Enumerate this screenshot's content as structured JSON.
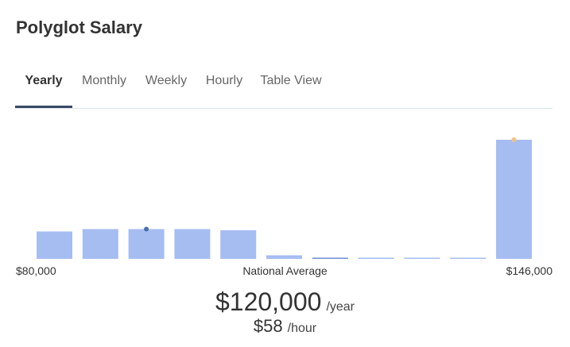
{
  "title": "Polyglot Salary",
  "tabs": [
    "Yearly",
    "Monthly",
    "Weekly",
    "Hourly",
    "Table View"
  ],
  "active_tab": "Yearly",
  "chart_data": {
    "type": "bar",
    "bars": [
      0.23,
      0.25,
      0.25,
      0.25,
      0.24,
      0.03,
      0.01,
      0.007,
      0.007,
      0.007,
      1.0
    ],
    "national_average_marker_bar": 2,
    "highlight_marker_bar": 10,
    "colors": {
      "bar": "#a6bdf2",
      "avg_marker": "#4a6fae",
      "highlight_marker": "#f2c28a"
    }
  },
  "range": {
    "min": "$80,000",
    "average_label": "National Average",
    "max": "$146,000"
  },
  "salary": {
    "yearly_amount": "$120,000",
    "yearly_unit": "/year",
    "hourly_amount": "$58",
    "hourly_unit": "/hour"
  }
}
